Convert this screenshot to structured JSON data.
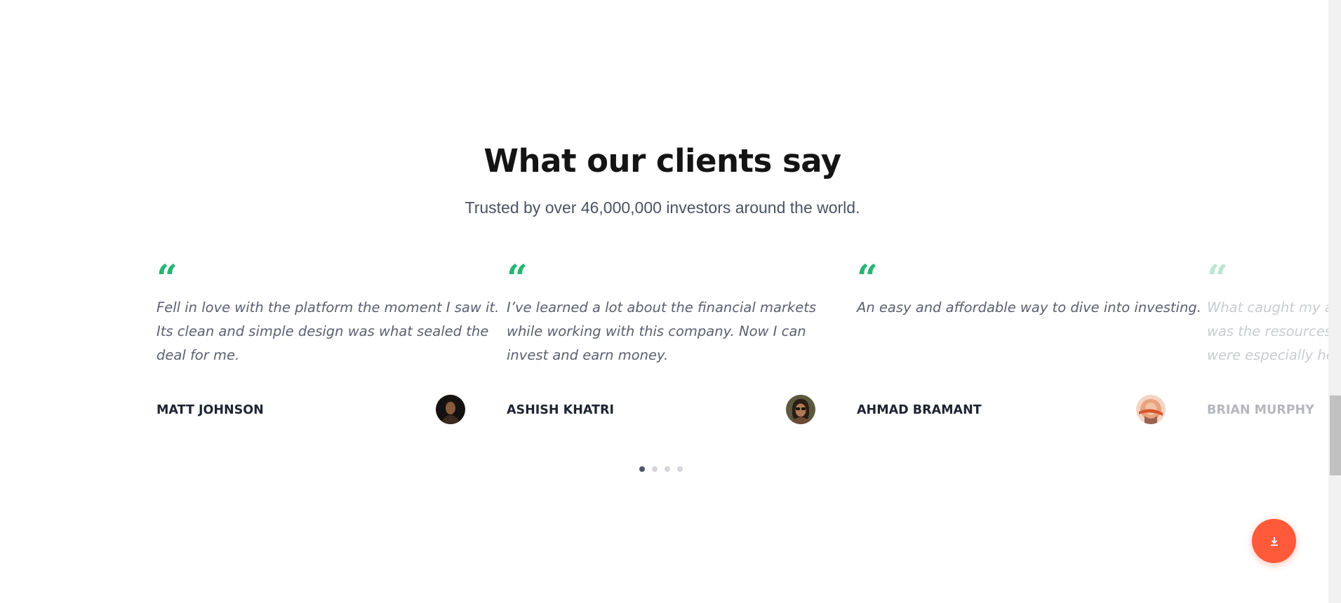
{
  "section": {
    "title": "What our clients say",
    "subtitle": "Trusted by over 46,000,000 investors around the world."
  },
  "testimonials": [
    {
      "quote_mark": "“",
      "lines": [
        "Fell in love with the platform the moment I saw it.",
        "Its clean and simple design was what sealed the",
        "deal for me."
      ],
      "author": "MATT JOHNSON",
      "avatar_icon": "avatar-photo"
    },
    {
      "quote_mark": "“",
      "lines": [
        "I’ve learned a lot about the financial markets",
        "while working with this company. Now I can",
        "invest and earn money."
      ],
      "author": "ASHISH KHATRI",
      "avatar_icon": "avatar-photo"
    },
    {
      "quote_mark": "“",
      "lines": [
        "An easy and affordable way to dive into investing."
      ],
      "author": "AHMAD BRAMANT",
      "avatar_icon": "avatar-photo"
    },
    {
      "quote_mark": "“",
      "lines": [
        "What caught my att",
        "was the resources o",
        "were especially help"
      ],
      "author": "BRIAN MURPHY",
      "avatar_icon": "avatar-photo"
    }
  ],
  "pagination": {
    "count": 4,
    "active": 1
  },
  "fab": {
    "icon": "download-icon",
    "color": "#ff5a3a"
  },
  "colors": {
    "accent": "#27b573",
    "heading": "#141414",
    "body_text": "#5b6070",
    "author": "#1f2433"
  }
}
